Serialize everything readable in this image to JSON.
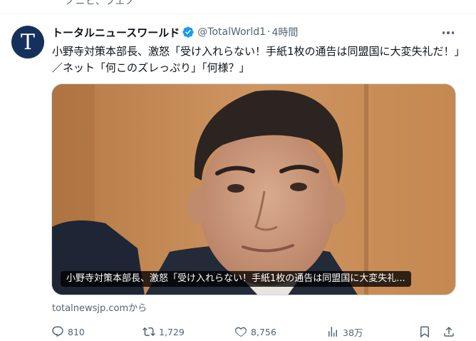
{
  "top_strip": {
    "text": "ノニヒ、フエノ"
  },
  "tweet": {
    "avatar_letter": "T",
    "display_name": "トータルニュースワールド",
    "handle": "@TotalWorld1",
    "dot": "·",
    "time": "4時間",
    "text": "小野寺対策本部長、激怒「受け入れらない！手紙1枚の通告は同盟国に大変失礼だ！」／ネット「何このズレっぷり」「何様？」",
    "card": {
      "caption": "小野寺対策本部長、激怒「受け入れらない！手紙1枚の通告は同盟国に大変失礼...",
      "domain": "totalnewsjp.comから"
    },
    "actions": {
      "reply_count": "810",
      "repost_count": "1,729",
      "like_count": "8,756",
      "views_count": "38万"
    }
  },
  "colors": {
    "text_primary": "#0f1419",
    "text_secondary": "#536471",
    "verified": "#1d9bf0",
    "avatar_bg": "#16305c"
  },
  "icons": [
    "verified-badge-icon",
    "more-icon",
    "reply-icon",
    "repost-icon",
    "like-icon",
    "views-icon",
    "bookmark-icon",
    "share-icon"
  ]
}
